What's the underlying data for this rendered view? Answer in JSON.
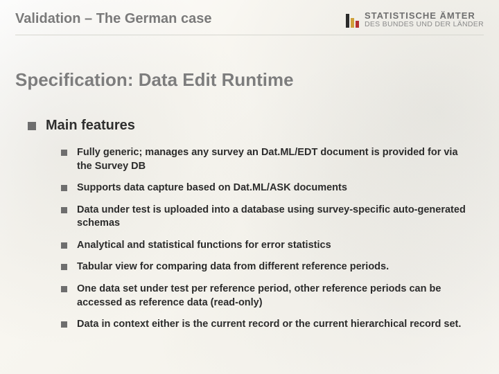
{
  "header": {
    "kicker": "Validation – The German case",
    "logo": {
      "line1": "STATISTISCHE ÄMTER",
      "line2": "DES BUNDES UND DER LÄNDER"
    }
  },
  "title": "Specification: Data Edit Runtime",
  "section": {
    "heading": "Main features",
    "items": [
      "Fully generic; manages any survey an Dat.ML/EDT document is provided for via the Survey DB",
      "Supports data capture based on Dat.ML/ASK documents",
      "Data under test is uploaded into a database using survey-specific auto-generated schemas",
      "Analytical and statistical functions for error statistics",
      "Tabular view for comparing data from different reference periods.",
      "One data set under test per reference period, other reference periods can be accessed as reference data (read-only)",
      "Data in context either is the current record or the current hierarchical record set."
    ]
  }
}
